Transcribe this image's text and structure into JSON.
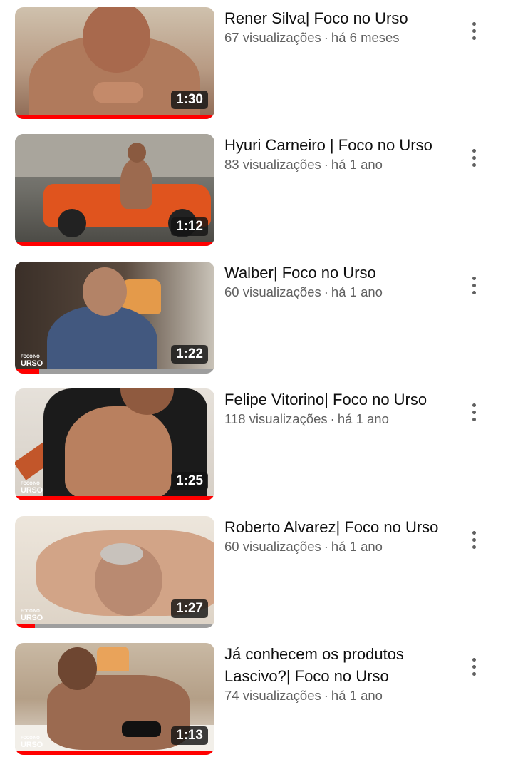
{
  "colors": {
    "progress_played": "#ff0000",
    "progress_track": "#9e9e9e",
    "title_text": "#0f0f0f",
    "meta_text": "#606060",
    "duration_badge": "#141414"
  },
  "videos": [
    {
      "title": "Rener Silva| Foco no Urso",
      "views": "67 visualizações",
      "separator": "·",
      "age": "há 6 meses",
      "duration": "1:30",
      "watched_fraction": 1.0,
      "brand_small": "",
      "brand_big": "",
      "menu_icon": "more-vertical-icon"
    },
    {
      "title": "Hyuri Carneiro | Foco no Urso",
      "views": "83 visualizações",
      "separator": "·",
      "age": "há 1 ano",
      "duration": "1:12",
      "watched_fraction": 1.0,
      "brand_small": "",
      "brand_big": "",
      "menu_icon": "more-vertical-icon"
    },
    {
      "title": "Walber| Foco no Urso",
      "views": "60 visualizações",
      "separator": "·",
      "age": "há 1 ano",
      "duration": "1:22",
      "watched_fraction": 0.12,
      "brand_small": "FOCO NO",
      "brand_big": "URSO",
      "menu_icon": "more-vertical-icon"
    },
    {
      "title": "Felipe Vitorino| Foco no Urso",
      "views": "118 visualizações",
      "separator": "·",
      "age": "há 1 ano",
      "duration": "1:25",
      "watched_fraction": 1.0,
      "brand_small": "FOCO NO",
      "brand_big": "URSO",
      "menu_icon": "more-vertical-icon"
    },
    {
      "title": "Roberto Alvarez| Foco no Urso",
      "views": "60 visualizações",
      "separator": "·",
      "age": "há 1 ano",
      "duration": "1:27",
      "watched_fraction": 0.1,
      "brand_small": "FOCO NO",
      "brand_big": "URSO",
      "menu_icon": "more-vertical-icon"
    },
    {
      "title": "Já conhecem os produtos Lascivo?| Foco no Urso",
      "views": "74 visualizações",
      "separator": "·",
      "age": "há 1 ano",
      "duration": "1:13",
      "watched_fraction": 1.0,
      "brand_small": "FOCO NO",
      "brand_big": "URSO",
      "menu_icon": "more-vertical-icon"
    }
  ]
}
